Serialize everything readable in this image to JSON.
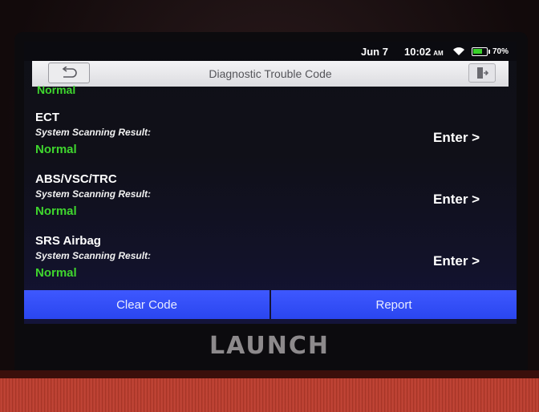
{
  "device": {
    "brand": "LAUNCH"
  },
  "statusbar": {
    "date": "Jun 7",
    "time": "10:02",
    "ampm": "AM",
    "battery": "70%",
    "battery_level": 0.7
  },
  "header": {
    "title": "Diagnostic Trouble Code",
    "back_icon": "back-arrow-icon",
    "exit_icon": "exit-door-icon"
  },
  "partial_item": {
    "status": "Normal"
  },
  "systems": [
    {
      "name": "ECT",
      "result_label": "System Scanning Result:",
      "status": "Normal",
      "enter_label": "Enter >"
    },
    {
      "name": "ABS/VSC/TRC",
      "result_label": "System Scanning Result:",
      "status": "Normal",
      "enter_label": "Enter >"
    },
    {
      "name": "SRS Airbag",
      "result_label": "System Scanning Result:",
      "status": "Normal",
      "enter_label": "Enter >"
    }
  ],
  "actions": {
    "clear_code": "Clear Code",
    "report": "Report"
  },
  "colors": {
    "status_ok": "#3fd62e",
    "action_blue": "#2f4bf5",
    "title_bg": "#e8e8ec"
  }
}
